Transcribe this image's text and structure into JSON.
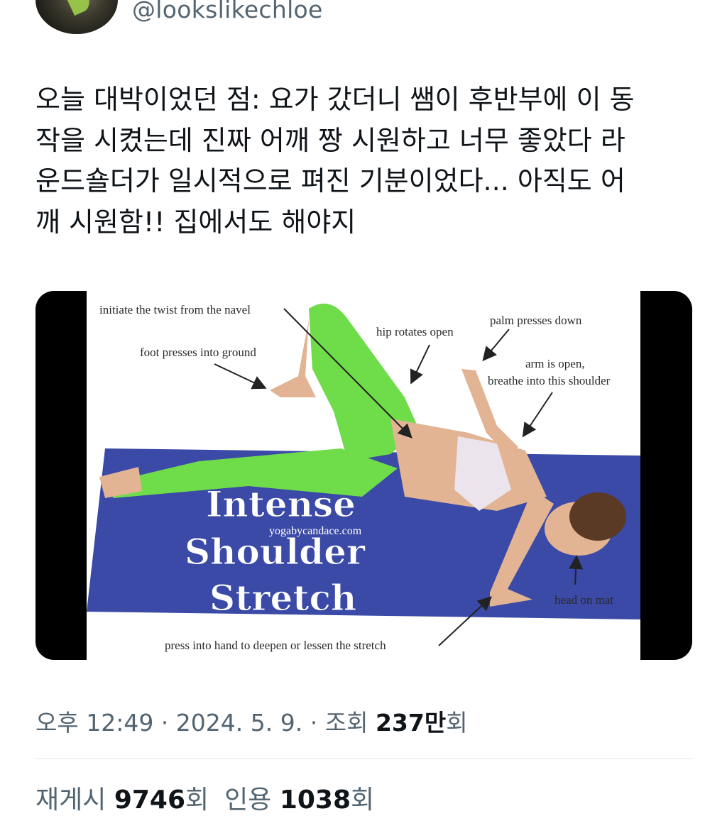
{
  "author": {
    "handle": "@lookslikechloe",
    "avatar_icon": "profile-photo"
  },
  "tweet": {
    "text": "오늘 대박이었던 점: 요가 갔더니 쌤이 후반부에 이 동\n작을 시켰는데 진짜 어깨 짱 시원하고 너무 좋았다 라\n운드숄더가 일시적으로 펴진 기분이었다... 아직도 어\n깨 시원함!! 집에서도 해야지"
  },
  "media": {
    "annotations": {
      "initiate": "initiate the twist from the navel",
      "foot": "foot presses into ground",
      "hip": "hip rotates open",
      "palm": "palm presses down",
      "arm1": "arm is open,",
      "arm2": "breathe into this shoulder",
      "head": "head on mat",
      "press": "press into hand to deepen or lessen the stretch"
    },
    "title_line1": "Intense",
    "title_line2": "Shoulder",
    "title_line3": "Stretch",
    "watermark": "yogabycandace.com"
  },
  "meta": {
    "time": "오후 12:49",
    "sep1": " · ",
    "date": "2024. 5. 9.",
    "sep2": " · ",
    "views_label": "조회 ",
    "views_value": "237만",
    "views_suffix": "회"
  },
  "stats": {
    "retweets_label": "재게시 ",
    "retweets_value": "9746",
    "retweets_suffix": "회",
    "quotes_label": "인용 ",
    "quotes_value": "1038",
    "quotes_suffix": "회"
  },
  "colors": {
    "mat": "#3b4aa6",
    "leggings": "#6fdc4a",
    "skin": "#e2b494",
    "top": "#ece4ec"
  }
}
